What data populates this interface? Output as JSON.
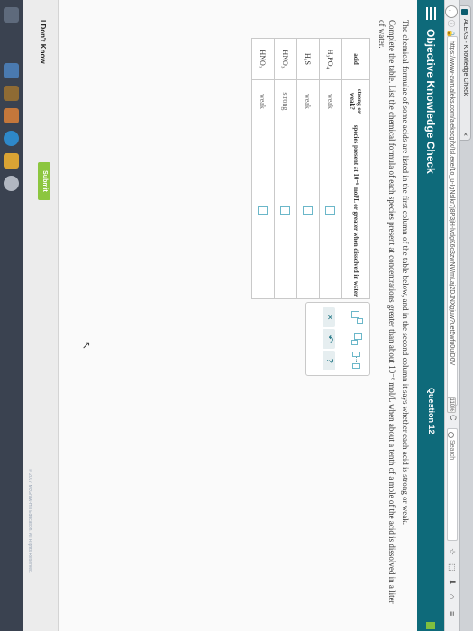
{
  "browser": {
    "tab_title": "ALEKS - Knowledge Check",
    "tab_close": "×",
    "back": "←",
    "info": "ⓘ 🔒",
    "url": "https://www-awn.aleks.com/alekscgi/x/Isl.exe/1o_u-IgNslkr7j8P3jH-lvdgK6c3zwNWmLaj2DJNXgjuw?uet5wfu0uiD0V",
    "zoom": "110%",
    "reload": "C",
    "search_placeholder": "Search",
    "toolbar_icons": [
      "☆",
      "⬚",
      "⬇",
      "⌂",
      "≡"
    ]
  },
  "header": {
    "title": "Objective Knowledge Check",
    "question": "Question 12"
  },
  "problem": {
    "para1": "The chemical formulae of some acids are listed in the first column of the table below, and in the second column it says whether each acid is strong or weak.",
    "para2": "Complete the table. List the chemical formula of each species present at concentrations greater than about 10⁻⁶ mol/L when about a tenth of a mole of the acid is dissolved in a liter of water."
  },
  "table": {
    "headers": {
      "acid": "acid",
      "strong_weak": "strong or weak?",
      "species": "species present at 10⁻⁶ mol/L or greater when dissolved in water"
    },
    "rows": [
      {
        "acid": "H₃PO₄",
        "strength": "weak"
      },
      {
        "acid": "H₂S",
        "strength": "weak"
      },
      {
        "acid": "HNO₃",
        "strength": "strong"
      },
      {
        "acid": "HNO₂",
        "strength": "weak"
      }
    ]
  },
  "palette": {
    "dots": "…",
    "clear": "×",
    "undo": "↶",
    "help": "?"
  },
  "footer": {
    "dont_know": "I Don't Know",
    "submit": "Submit",
    "copyright": "© 2017 McGraw-Hill Education. All Rights Reserved."
  }
}
